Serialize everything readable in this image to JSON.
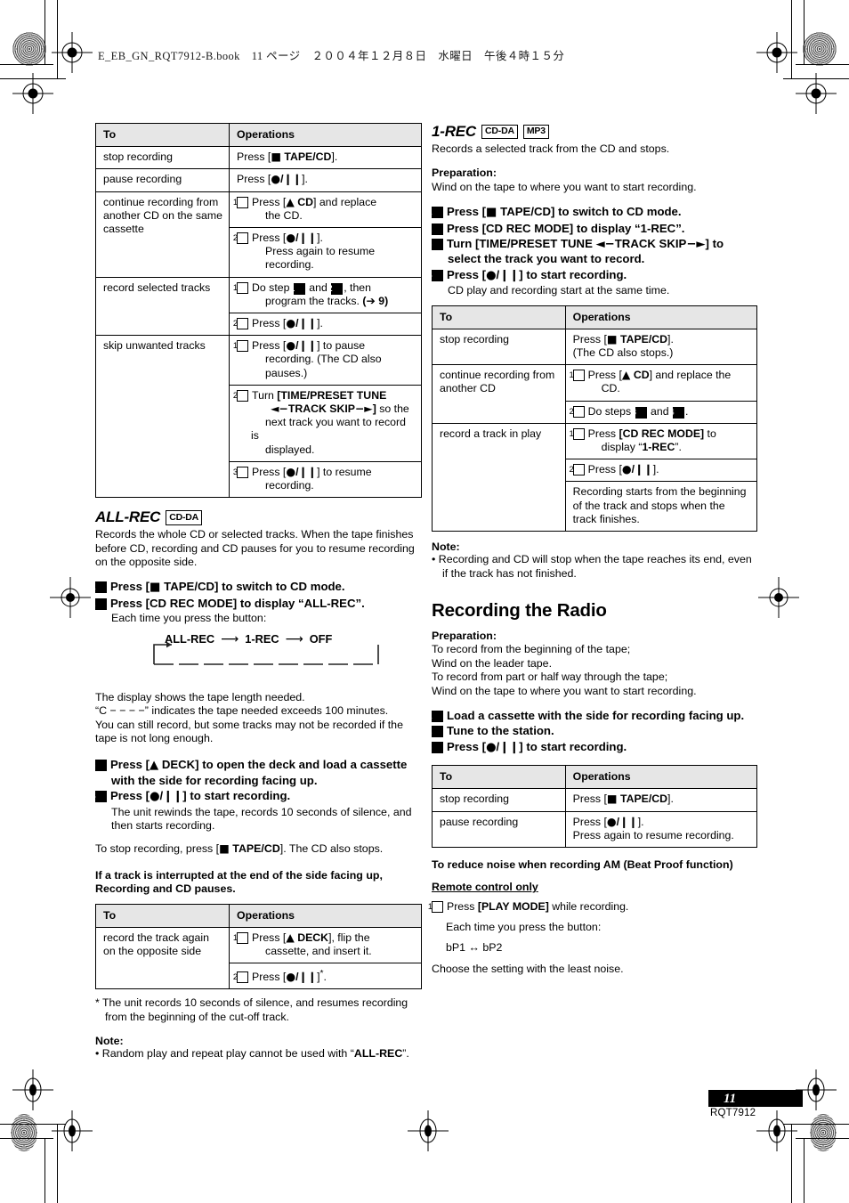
{
  "header": {
    "line": "E_EB_GN_RQT7912-B.book　11 ページ　２００４年１２月８日　水曜日　午後４時１５分"
  },
  "left_column": {
    "table_allrec_ops": {
      "headers": [
        "To",
        "Operations"
      ],
      "rows": [
        {
          "to": "stop recording",
          "ops": [
            {
              "num": null,
              "text": "Press [■ TAPE/CD]."
            }
          ]
        },
        {
          "to": "pause recording",
          "ops": [
            {
              "num": null,
              "text": "Press [●/▮▮]."
            }
          ]
        },
        {
          "to": "continue recording from another CD on the same cassette",
          "ops": [
            {
              "num": "1",
              "text": "Press [▲ CD] and replace the CD."
            },
            {
              "num": "2",
              "text": "Press [●/▮▮]. Press again to resume recording."
            }
          ]
        },
        {
          "to": "record selected tracks",
          "ops": [
            {
              "num": "1",
              "text": "Do step 1 and 2, then program the tracks. (➔ 9)"
            },
            {
              "num": "2",
              "text": "Press [●/▮▮]."
            }
          ]
        },
        {
          "to": "skip unwanted tracks",
          "ops": [
            {
              "num": "1",
              "text": "Press [●/▮▮] to pause recording. (The CD also pauses.)"
            },
            {
              "num": "2",
              "text": "Turn [TIME/PRESET TUNE ◄TRACK SKIP►] so the next track you want to record is displayed."
            },
            {
              "num": "3",
              "text": "Press [●/▮▮] to resume recording."
            }
          ]
        }
      ]
    },
    "allrec": {
      "title": "ALL-REC",
      "badges": [
        "CD-DA"
      ],
      "intro": "Records the whole CD or selected tracks. When the tape finishes before CD, recording and CD pauses for you to resume recording on the opposite side.",
      "steps": [
        {
          "num": "1",
          "text": "Press [■ TAPE/CD] to switch to CD mode."
        },
        {
          "num": "2",
          "text": "Press [CD REC MODE] to display “ALL-REC”.",
          "sub": "Each time you press the button:"
        }
      ],
      "cycle": {
        "items": [
          "ALL-REC",
          "1-REC",
          "OFF"
        ],
        "arrow": "⟶"
      },
      "after_cycle": [
        "The display shows the tape length needed.",
        "“C − − − −” indicates the tape needed exceeds 100 minutes.",
        "You can still record, but some tracks may not be recorded if the tape is not long enough."
      ],
      "steps2": [
        {
          "num": "3",
          "text": "Press [▲ DECK] to open the deck and load a cassette with the side for recording facing up."
        },
        {
          "num": "4",
          "text": "Press [●/▮▮] to start recording.",
          "sub": "The unit rewinds the tape, records 10 seconds of silence, and then starts recording."
        }
      ],
      "stop_note": "To stop recording, press [■ TAPE/CD]. The CD also stops.",
      "interrupt_note": "If a track is interrupted at the end of the side facing up, Recording and CD pauses."
    },
    "table_interrupt": {
      "headers": [
        "To",
        "Operations"
      ],
      "rows": [
        {
          "to": "record the track again on the opposite side",
          "ops": [
            {
              "num": "1",
              "text": "Press [▲ DECK], flip the cassette, and insert it."
            },
            {
              "num": "2",
              "text": "Press [●/▮▮]*."
            }
          ]
        }
      ]
    },
    "footnote": "* The unit records 10 seconds of silence, and resumes recording from the beginning of the cut-off track.",
    "note_title": "Note:",
    "note_bullet": "• Random play and repeat play cannot be used with “ALL-REC”."
  },
  "right_column": {
    "onerec": {
      "title": "1-REC",
      "badges": [
        "CD-DA",
        "MP3"
      ],
      "intro": "Records a selected track from the CD and stops.",
      "prep_title": "Preparation:",
      "prep_text": "Wind on the tape to where you want to start recording.",
      "steps": [
        {
          "num": "1",
          "text": "Press [■ TAPE/CD] to switch to CD mode."
        },
        {
          "num": "2",
          "text": "Press [CD REC MODE] to display “1-REC”."
        },
        {
          "num": "3",
          "text": "Turn [TIME/PRESET TUNE ◄TRACK SKIP►] to select the track you want to record."
        },
        {
          "num": "4",
          "text": "Press [●/▮▮] to start recording.",
          "sub": "CD play and recording start at the same time."
        }
      ]
    },
    "table_onerec_ops": {
      "headers": [
        "To",
        "Operations"
      ],
      "rows": [
        {
          "to": "stop recording",
          "ops": [
            {
              "num": null,
              "text": "Press [■ TAPE/CD]. (The CD also stops.)"
            }
          ]
        },
        {
          "to": "continue recording from another CD",
          "ops": [
            {
              "num": "1",
              "text": "Press [▲ CD] and replace the CD."
            },
            {
              "num": "2",
              "text": "Do steps 3 and 4."
            }
          ]
        },
        {
          "to": "record a track in play",
          "ops": [
            {
              "num": "1",
              "text": "Press [CD REC MODE] to display “1-REC”."
            },
            {
              "num": "2",
              "text": "Press [●/▮▮]."
            },
            {
              "num": null,
              "text": "Recording starts from the beginning of the track and stops when the track finishes."
            }
          ]
        }
      ]
    },
    "note_title": "Note:",
    "note_bullet": "• Recording and CD will stop when the tape reaches its end, even if the track has not finished.",
    "radio": {
      "heading": "Recording the Radio",
      "prep_title": "Preparation:",
      "prep_lines": [
        "To record from the beginning of the tape;",
        "Wind on the leader tape.",
        "To record from part or half way through the tape;",
        "Wind on the tape to where you want to start recording."
      ],
      "steps": [
        {
          "num": "1",
          "text": "Load a cassette with the side for recording facing up."
        },
        {
          "num": "2",
          "text": "Tune to the station."
        },
        {
          "num": "3",
          "text": "Press [●/▮▮] to start recording."
        }
      ],
      "table": {
        "headers": [
          "To",
          "Operations"
        ],
        "rows": [
          {
            "to": "stop recording",
            "ops": [
              {
                "num": null,
                "text": "Press [■ TAPE/CD]."
              }
            ]
          },
          {
            "to": "pause recording",
            "ops": [
              {
                "num": null,
                "text": "Press [●/▮▮]. Press again to resume recording."
              }
            ]
          }
        ]
      },
      "beat_title": "To reduce noise when recording AM (Beat Proof function)",
      "remote_only": "Remote control only",
      "beat_step": "Press [PLAY MODE] while recording.",
      "beat_each": "Each time you press the button:",
      "beat_cycle": "bP1 ↔ bP2",
      "beat_choose": "Choose the setting with the least noise."
    }
  },
  "footer": {
    "page_number": "11",
    "code": "RQT7912"
  }
}
